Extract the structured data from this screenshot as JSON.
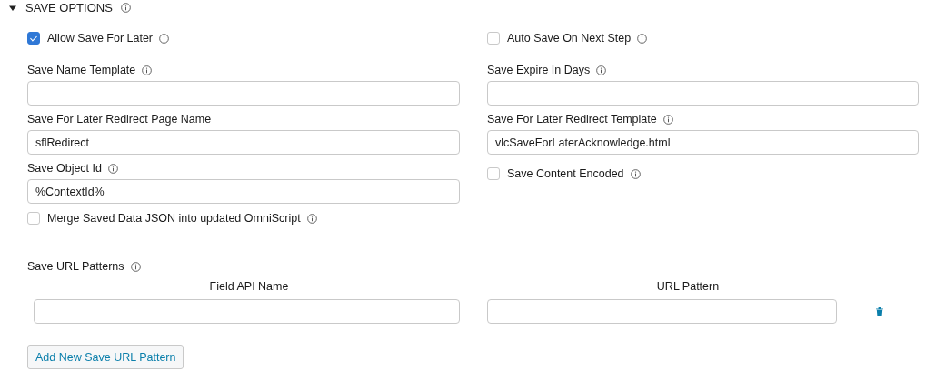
{
  "section": {
    "title": "SAVE OPTIONS",
    "expanded": true
  },
  "rows": [
    [
      {
        "kind": "checkbox",
        "label": "Allow Save For Later",
        "checked": true,
        "info": true
      },
      {
        "kind": "checkbox",
        "label": "Auto Save On Next Step",
        "checked": false,
        "info": true
      }
    ],
    [
      {
        "kind": "field",
        "label": "Save Name Template",
        "info": true
      },
      {
        "kind": "field",
        "label": "Save Expire In Days",
        "info": true
      }
    ],
    [
      {
        "kind": "field",
        "label": "Save For Later Redirect Page Name",
        "value": "sflRedirect",
        "info": false
      },
      {
        "kind": "field",
        "label": "Save For Later Redirect Template",
        "value": "vlcSaveForLaterAcknowledge.html",
        "info": true
      }
    ],
    [
      {
        "kind": "field",
        "label": "Save Object Id",
        "value": "%ContextId%",
        "info": true
      },
      {
        "kind": "checkbox",
        "label": "Save Content Encoded",
        "checked": false,
        "info": true
      }
    ],
    [
      {
        "kind": "checkbox",
        "label": "Merge Saved Data JSON into updated OmniScript",
        "checked": false,
        "info": true
      }
    ]
  ],
  "url_patterns": {
    "label": "Save URL Patterns",
    "info": true,
    "columns": [
      "Field API Name",
      "URL Pattern"
    ],
    "rows": [
      {}
    ],
    "add_button": "Add New Save URL Pattern"
  }
}
